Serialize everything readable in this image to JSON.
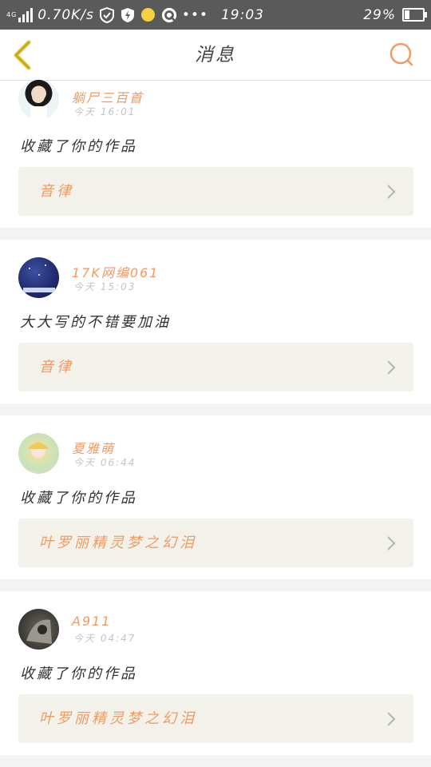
{
  "status_bar": {
    "network": "4G",
    "speed": "0.70K/s",
    "time": "19:03",
    "battery": "29%",
    "battery_level": 0.29
  },
  "header": {
    "title": "消息"
  },
  "messages": [
    {
      "user": "躺尸三百首",
      "time": "今天 16:01",
      "text": "收藏了你的作品",
      "work": "音律"
    },
    {
      "user": "17K网编061",
      "time": "今天 15:03",
      "text": "大大写的不错要加油",
      "work": "音律"
    },
    {
      "user": "夏雅萌",
      "time": "今天 06:44",
      "text": "收藏了你的作品",
      "work": "叶罗丽精灵梦之幻泪"
    },
    {
      "user": "A911",
      "time": "今天 04:47",
      "text": "收藏了你的作品",
      "work": "叶罗丽精灵梦之幻泪"
    }
  ],
  "colors": {
    "accent": "#f19a62",
    "back_arrow": "#e0c22e",
    "statusbar": "#5a5a5a",
    "card_sub": "#f2f2ea"
  }
}
